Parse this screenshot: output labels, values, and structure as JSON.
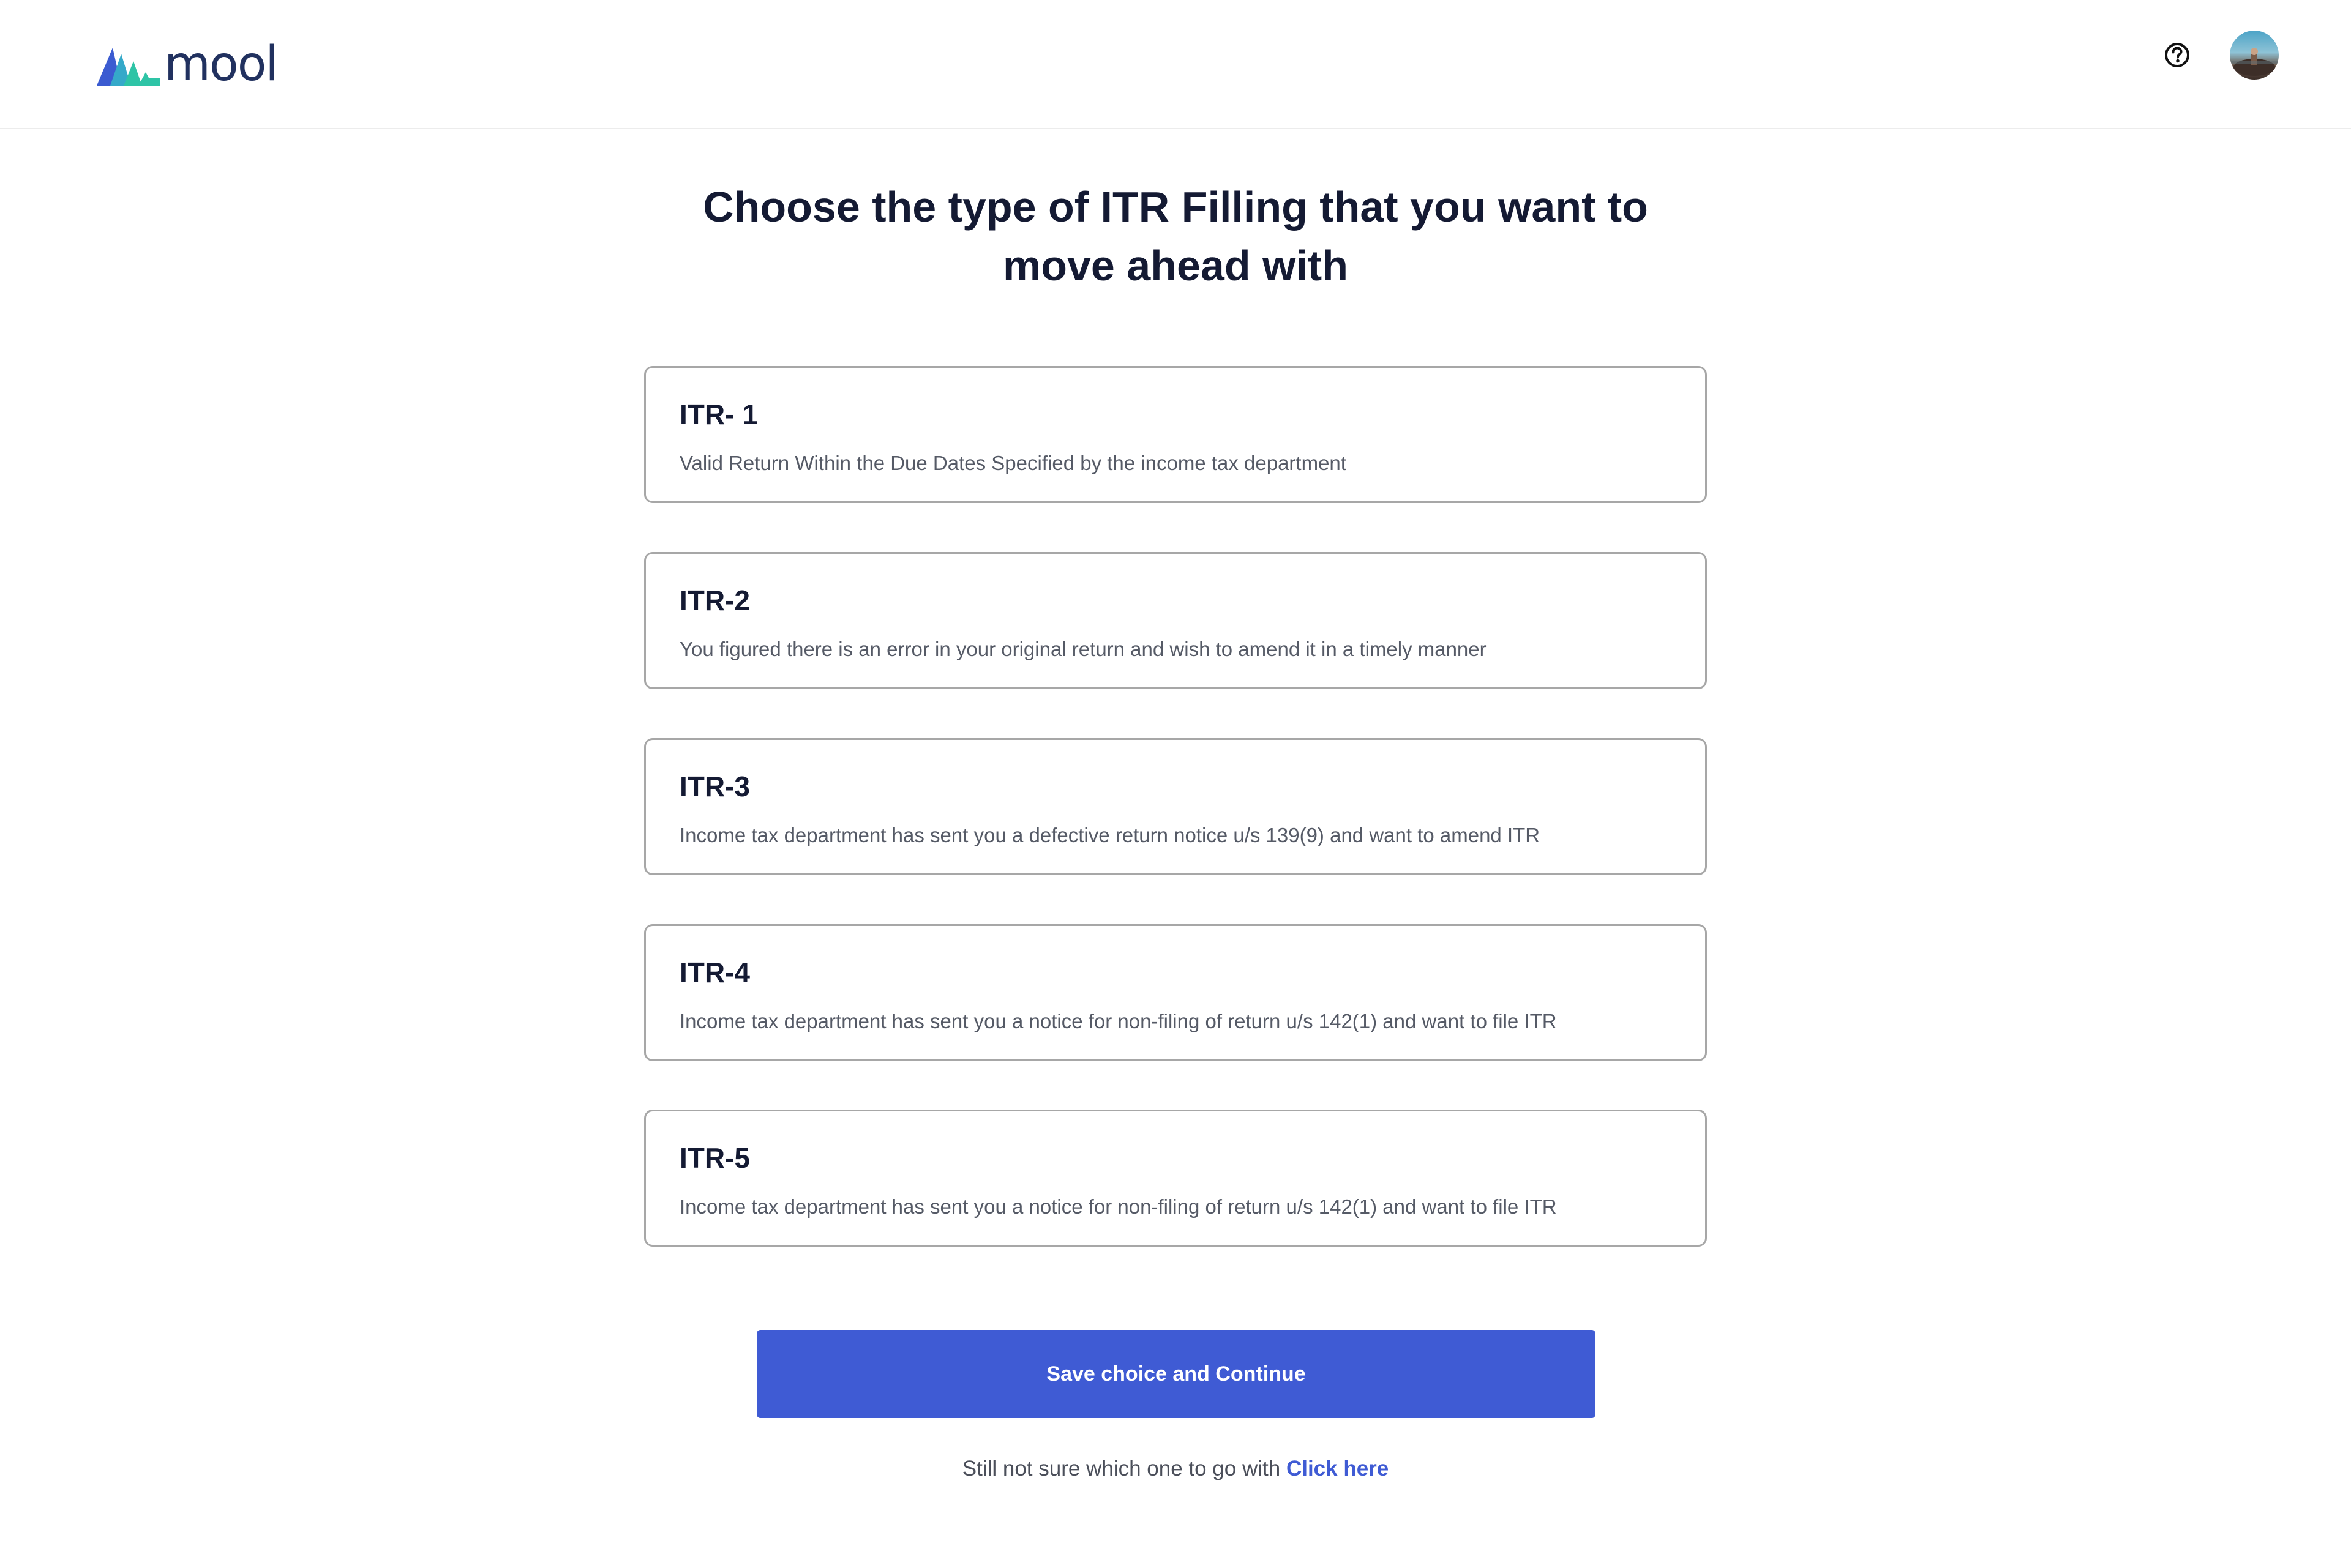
{
  "header": {
    "brand": "mool",
    "help_icon": "question-circle-icon",
    "avatar_icon": "user-avatar"
  },
  "main": {
    "title_line1": "Choose the type of ITR Filling that you want to",
    "title_line2": "move ahead with",
    "options": [
      {
        "title": "ITR- 1",
        "description": "Valid Return Within the Due Dates Specified by the income tax department"
      },
      {
        "title": "ITR-2",
        "description": "You figured there is an error in your original return and wish to amend it in a timely manner"
      },
      {
        "title": "ITR-3",
        "description": "Income tax department has sent you a defective return notice u/s 139(9) and want to amend ITR"
      },
      {
        "title": "ITR-4",
        "description": "Income tax department has sent you a notice for non-filing of return u/s 142(1) and want to file ITR"
      },
      {
        "title": "ITR-5",
        "description": "Income tax department has sent you a notice for non-filing of return u/s 142(1) and want to file ITR"
      }
    ],
    "cta_label": "Save choice and Continue",
    "hint_text": "Still not sure which one to go with",
    "hint_link": "Click here"
  },
  "colors": {
    "primary": "#3f5bd4",
    "heading": "#141a33",
    "body_text": "#555a66",
    "card_border": "#a7a7a7",
    "logo_blue": "#3b5bd1",
    "logo_teal": "#2ec4a6"
  }
}
